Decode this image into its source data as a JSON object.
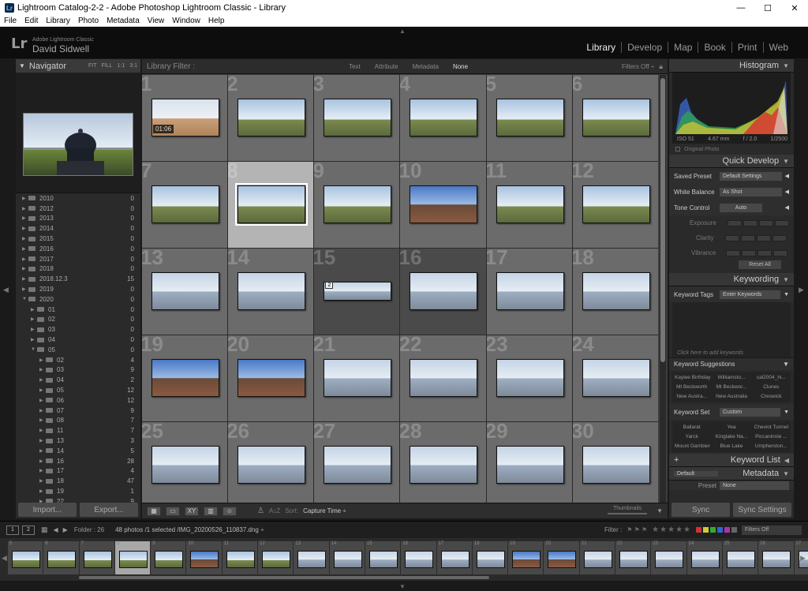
{
  "window": {
    "title": "Lightroom Catalog-2-2 - Adobe Photoshop Lightroom Classic - Library",
    "app_icon": "Lr",
    "minimize": "—",
    "maximize": "☐",
    "close": "✕"
  },
  "menu": [
    "File",
    "Edit",
    "Library",
    "Photo",
    "Metadata",
    "View",
    "Window",
    "Help"
  ],
  "identity": {
    "logo": "Lr",
    "app_name": "Adobe Lightroom Classic",
    "user": "David Sidwell"
  },
  "modules": [
    "Library",
    "Develop",
    "Map",
    "Book",
    "Print",
    "Web"
  ],
  "active_module": "Library",
  "navigator": {
    "title": "Navigator",
    "options": [
      "FIT",
      "FILL",
      "1:1",
      "3:1"
    ]
  },
  "folders": [
    {
      "name": "2010",
      "count": "0",
      "depth": 0,
      "expanded": false
    },
    {
      "name": "2012",
      "count": "0",
      "depth": 0,
      "expanded": false
    },
    {
      "name": "2013",
      "count": "0",
      "depth": 0,
      "expanded": false
    },
    {
      "name": "2014",
      "count": "0",
      "depth": 0,
      "expanded": false
    },
    {
      "name": "2015",
      "count": "0",
      "depth": 0,
      "expanded": false
    },
    {
      "name": "2016",
      "count": "0",
      "depth": 0,
      "expanded": false
    },
    {
      "name": "2017",
      "count": "0",
      "depth": 0,
      "expanded": false
    },
    {
      "name": "2018",
      "count": "0",
      "depth": 0,
      "expanded": false
    },
    {
      "name": "2018.12.3",
      "count": "15",
      "depth": 0,
      "expanded": false
    },
    {
      "name": "2019",
      "count": "0",
      "depth": 0,
      "expanded": false
    },
    {
      "name": "2020",
      "count": "0",
      "depth": 0,
      "expanded": true
    },
    {
      "name": "01",
      "count": "0",
      "depth": 1,
      "expanded": false
    },
    {
      "name": "02",
      "count": "0",
      "depth": 1,
      "expanded": false
    },
    {
      "name": "03",
      "count": "0",
      "depth": 1,
      "expanded": false
    },
    {
      "name": "04",
      "count": "0",
      "depth": 1,
      "expanded": false
    },
    {
      "name": "05",
      "count": "0",
      "depth": 1,
      "expanded": true
    },
    {
      "name": "02",
      "count": "4",
      "depth": 2,
      "expanded": false
    },
    {
      "name": "03",
      "count": "9",
      "depth": 2,
      "expanded": false
    },
    {
      "name": "04",
      "count": "2",
      "depth": 2,
      "expanded": false
    },
    {
      "name": "05",
      "count": "12",
      "depth": 2,
      "expanded": false
    },
    {
      "name": "06",
      "count": "12",
      "depth": 2,
      "expanded": false
    },
    {
      "name": "07",
      "count": "9",
      "depth": 2,
      "expanded": false
    },
    {
      "name": "08",
      "count": "7",
      "depth": 2,
      "expanded": false
    },
    {
      "name": "11",
      "count": "7",
      "depth": 2,
      "expanded": false
    },
    {
      "name": "13",
      "count": "3",
      "depth": 2,
      "expanded": false
    },
    {
      "name": "14",
      "count": "5",
      "depth": 2,
      "expanded": false
    },
    {
      "name": "16",
      "count": "28",
      "depth": 2,
      "expanded": false
    },
    {
      "name": "17",
      "count": "4",
      "depth": 2,
      "expanded": false
    },
    {
      "name": "18",
      "count": "47",
      "depth": 2,
      "expanded": false
    },
    {
      "name": "19",
      "count": "1",
      "depth": 2,
      "expanded": false
    },
    {
      "name": "22",
      "count": "9",
      "depth": 2,
      "expanded": false
    }
  ],
  "left_buttons": {
    "import": "Import...",
    "export": "Export..."
  },
  "filter_bar": {
    "label": "Library Filter :",
    "tabs": [
      "Text",
      "Attribute",
      "Metadata",
      "None"
    ],
    "selected": "None",
    "filters_off": "Filters Off ÷"
  },
  "grid_cells": [
    {
      "num": "1",
      "style": "normal",
      "duration": "01:06"
    },
    {
      "num": "2",
      "style": "normal"
    },
    {
      "num": "3",
      "style": "normal"
    },
    {
      "num": "4",
      "style": "normal"
    },
    {
      "num": "5",
      "style": "normal"
    },
    {
      "num": "6",
      "style": "normal"
    },
    {
      "num": "7",
      "style": "normal"
    },
    {
      "num": "8",
      "style": "selected"
    },
    {
      "num": "9",
      "style": "normal"
    },
    {
      "num": "10",
      "style": "normal"
    },
    {
      "num": "11",
      "style": "normal"
    },
    {
      "num": "12",
      "style": "normal"
    },
    {
      "num": "13",
      "style": "normal"
    },
    {
      "num": "14",
      "style": "normal"
    },
    {
      "num": "15",
      "style": "dark",
      "stack": "2"
    },
    {
      "num": "16",
      "style": "dark"
    },
    {
      "num": "17",
      "style": "normal"
    },
    {
      "num": "18",
      "style": "normal"
    },
    {
      "num": "19",
      "style": "normal"
    },
    {
      "num": "20",
      "style": "normal"
    },
    {
      "num": "21",
      "style": "normal"
    },
    {
      "num": "22",
      "style": "normal"
    },
    {
      "num": "23",
      "style": "normal"
    },
    {
      "num": "24",
      "style": "normal"
    },
    {
      "num": "25",
      "style": "normal"
    },
    {
      "num": "26",
      "style": "normal"
    },
    {
      "num": "27",
      "style": "normal"
    },
    {
      "num": "28",
      "style": "normal"
    },
    {
      "num": "29",
      "style": "normal"
    },
    {
      "num": "30",
      "style": "normal"
    }
  ],
  "toolbar": {
    "sort_label": "Sort:",
    "sort_value": "Capture Time ÷",
    "thumbnails_label": "Thumbnails"
  },
  "histogram": {
    "title": "Histogram",
    "iso": "ISO 51",
    "focal": "4.67 mm",
    "aperture": "f / 2.0",
    "shutter": "1/2500",
    "original_photo": "Original Photo"
  },
  "quick_develop": {
    "title": "Quick Develop",
    "saved_preset_label": "Saved Preset",
    "saved_preset_value": "Default Settings",
    "white_balance_label": "White Balance",
    "white_balance_value": "As Shot",
    "tone_control_label": "Tone Control",
    "tone_control_value": "Auto",
    "exposure": "Exposure",
    "clarity": "Clarity",
    "vibrance": "Vibrance",
    "reset_all": "Reset All"
  },
  "keywording": {
    "title": "Keywording",
    "keyword_tags_label": "Keyword Tags",
    "keyword_tags_value": "Enter Keywords",
    "hint": "Click here to add keywords",
    "suggestions_label": "Keyword Suggestions",
    "suggestions": [
      "Kaylee Birthday",
      "Williamsto...",
      "cal2004_hi...",
      "Mt Beckworth",
      "Mt Beckwor...",
      "Clunes",
      "New Austra...",
      "New Australia",
      "Creswick"
    ],
    "set_label": "Keyword Set",
    "set_value": "Custom",
    "set_items": [
      "Ballarat",
      "Yea",
      "Cheviot Tunnel",
      "Yarck",
      "Kinglake Na...",
      "Piccaninnie ...",
      "Mount Gambier",
      "Blue Lake",
      "Umpherston..."
    ]
  },
  "keyword_list": {
    "title": "Keyword List",
    "plus": "+"
  },
  "metadata": {
    "title": "Metadata",
    "preset_dropdown": "Default",
    "preset_label": "Preset",
    "preset_value": "None"
  },
  "sync_buttons": {
    "sync": "Sync",
    "sync_settings": "Sync Settings"
  },
  "filmstrip_bar": {
    "box1": "1",
    "box2": "2",
    "folder": "Folder : 26",
    "info": "48 photos /1 selected /IMG_20200526_110837.dng ÷",
    "filter_label": "Filter :",
    "filters_off": "Filters Off",
    "stars": "★★★★★"
  },
  "filmstrip": {
    "cells": [
      "5",
      "6",
      "7",
      "8",
      "9",
      "10",
      "11",
      "12",
      "13",
      "14",
      "15",
      "16",
      "17",
      "18",
      "19",
      "20",
      "21",
      "22",
      "23",
      "24",
      "25",
      "26",
      "27"
    ],
    "selected": "8"
  },
  "colors": {
    "bg": "#1a1a1a",
    "panel": "#2a2a2a",
    "grid_cell": "#6b6b6b",
    "selected_cell": "#b4b4b4",
    "text": "#bbbbbb"
  }
}
